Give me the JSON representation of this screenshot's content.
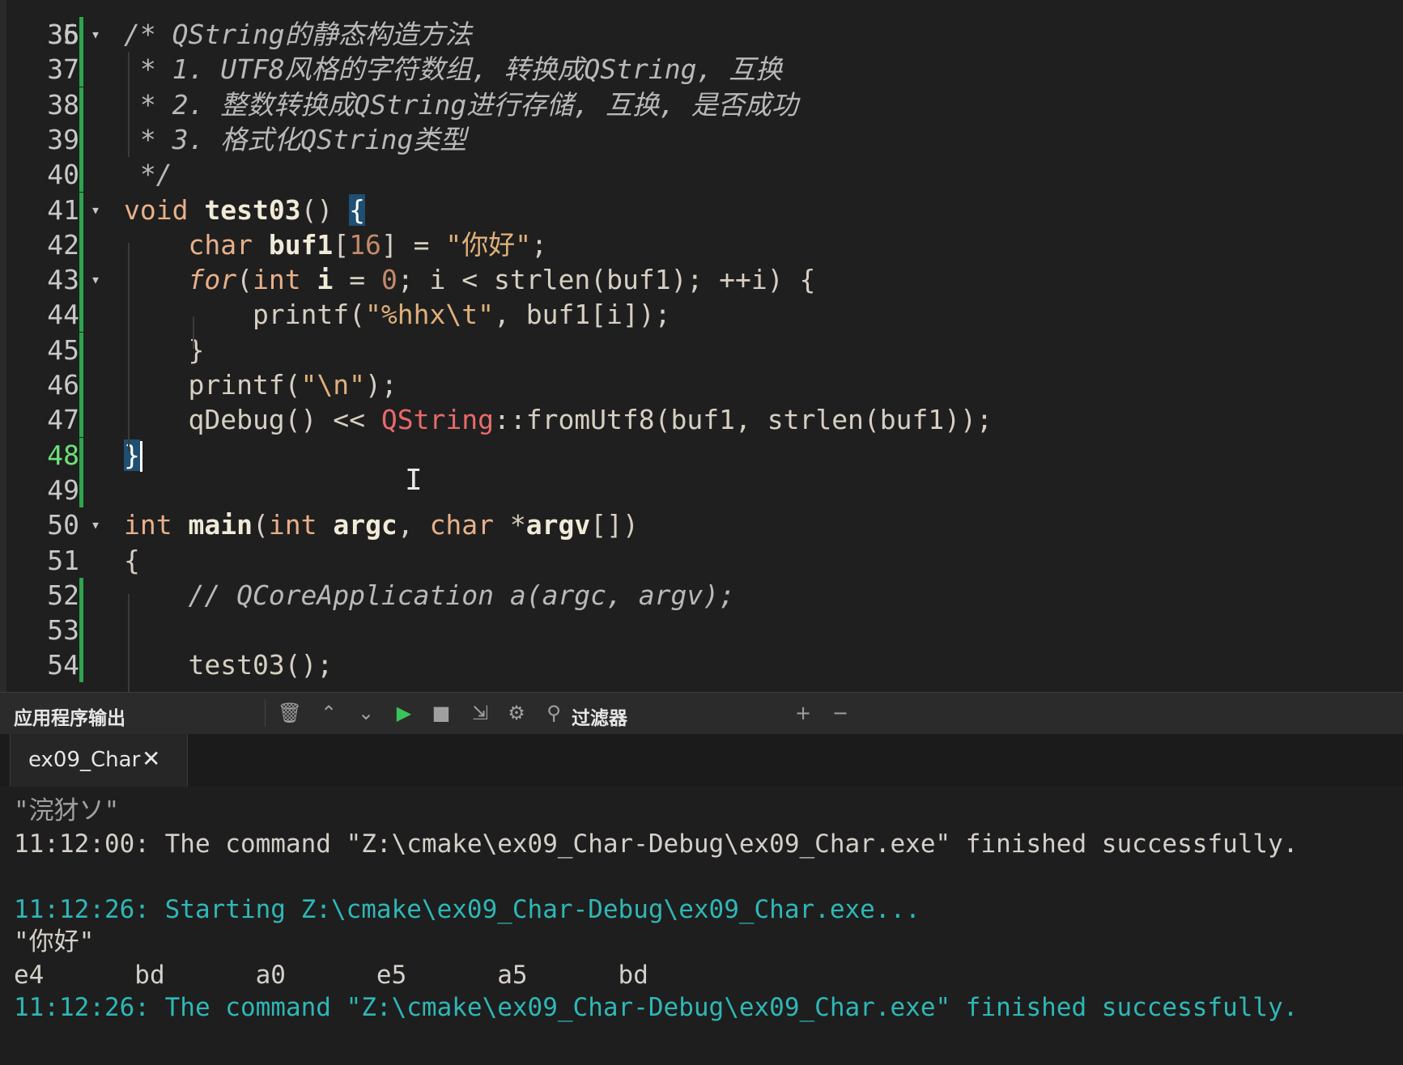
{
  "editor": {
    "lines": [
      {
        "n": "36",
        "fold": true,
        "mod": true,
        "segs": [
          {
            "c": "c-com",
            "t": "/* QString的静态构造方法"
          }
        ]
      },
      {
        "n": "37",
        "fold": false,
        "mod": true,
        "segs": [
          {
            "c": "c-com",
            "t": " * 1. UTF8风格的字符数组, 转换成QString, 互换"
          }
        ]
      },
      {
        "n": "38",
        "fold": false,
        "mod": true,
        "segs": [
          {
            "c": "c-com",
            "t": " * 2. 整数转换成QString进行存储, 互换, 是否成功"
          }
        ]
      },
      {
        "n": "39",
        "fold": false,
        "mod": true,
        "segs": [
          {
            "c": "c-com",
            "t": " * 3. 格式化QString类型"
          }
        ]
      },
      {
        "n": "40",
        "fold": false,
        "mod": true,
        "segs": [
          {
            "c": "c-com",
            "t": " */"
          }
        ]
      },
      {
        "n": "41",
        "fold": true,
        "mod": true,
        "segs": [
          {
            "c": "c-kw",
            "t": "void "
          },
          {
            "c": "c-fn",
            "t": "test03"
          },
          {
            "c": "",
            "t": "() "
          },
          {
            "c": "brace-hl",
            "t": "{"
          }
        ]
      },
      {
        "n": "42",
        "fold": false,
        "mod": true,
        "segs": [
          {
            "c": "",
            "t": "    "
          },
          {
            "c": "c-kw",
            "t": "char "
          },
          {
            "c": "c-fn",
            "t": "buf1"
          },
          {
            "c": "",
            "t": "["
          },
          {
            "c": "c-num",
            "t": "16"
          },
          {
            "c": "",
            "t": "] = "
          },
          {
            "c": "c-str",
            "t": "\"你好\""
          },
          {
            "c": "",
            "t": ";"
          }
        ]
      },
      {
        "n": "43",
        "fold": true,
        "mod": true,
        "segs": [
          {
            "c": "",
            "t": "    "
          },
          {
            "c": "c-kw c-it",
            "t": "for"
          },
          {
            "c": "",
            "t": "("
          },
          {
            "c": "c-kw",
            "t": "int "
          },
          {
            "c": "c-fn",
            "t": "i"
          },
          {
            "c": "",
            "t": " = "
          },
          {
            "c": "c-num",
            "t": "0"
          },
          {
            "c": "",
            "t": "; i < strlen(buf1); ++i) {"
          }
        ]
      },
      {
        "n": "44",
        "fold": false,
        "mod": true,
        "segs": [
          {
            "c": "",
            "t": "        printf("
          },
          {
            "c": "c-str",
            "t": "\"%hhx\\t\""
          },
          {
            "c": "",
            "t": ", buf1[i]);"
          }
        ]
      },
      {
        "n": "45",
        "fold": false,
        "mod": true,
        "segs": [
          {
            "c": "",
            "t": "    }"
          }
        ]
      },
      {
        "n": "46",
        "fold": false,
        "mod": true,
        "segs": [
          {
            "c": "",
            "t": "    printf("
          },
          {
            "c": "c-str",
            "t": "\"\\n\""
          },
          {
            "c": "",
            "t": ");"
          }
        ]
      },
      {
        "n": "47",
        "fold": false,
        "mod": true,
        "segs": [
          {
            "c": "",
            "t": "    qDebug() << "
          },
          {
            "c": "c-cls",
            "t": "QString"
          },
          {
            "c": "",
            "t": "::fromUtf8(buf1, strlen(buf1));"
          }
        ]
      },
      {
        "n": "48",
        "fold": false,
        "mod": true,
        "current": true,
        "segs": [
          {
            "c": "brace-hl",
            "t": "}"
          }
        ],
        "caret": true
      },
      {
        "n": "49",
        "fold": false,
        "mod": true,
        "segs": []
      },
      {
        "n": "50",
        "fold": true,
        "mod": false,
        "segs": [
          {
            "c": "c-kw",
            "t": "int "
          },
          {
            "c": "c-fn",
            "t": "main"
          },
          {
            "c": "",
            "t": "("
          },
          {
            "c": "c-kw",
            "t": "int "
          },
          {
            "c": "c-fn",
            "t": "argc"
          },
          {
            "c": "",
            "t": ", "
          },
          {
            "c": "c-kw",
            "t": "char "
          },
          {
            "c": "",
            "t": "*"
          },
          {
            "c": "c-fn",
            "t": "argv"
          },
          {
            "c": "",
            "t": "[])"
          }
        ]
      },
      {
        "n": "51",
        "fold": false,
        "mod": false,
        "segs": [
          {
            "c": "",
            "t": "{"
          }
        ]
      },
      {
        "n": "52",
        "fold": false,
        "mod": true,
        "segs": [
          {
            "c": "",
            "t": "    "
          },
          {
            "c": "c-com",
            "t": "// QCoreApplication a(argc, argv);"
          }
        ]
      },
      {
        "n": "53",
        "fold": false,
        "mod": true,
        "segs": []
      },
      {
        "n": "54",
        "fold": false,
        "mod": true,
        "segs": [
          {
            "c": "",
            "t": "    test03();"
          }
        ]
      }
    ],
    "top_partial_line_number": "35"
  },
  "output_pane": {
    "title": "应用程序输出",
    "filter_label": "过滤器",
    "icons": {
      "clear": "trash-icon",
      "prev": "chevron-up-icon",
      "next": "chevron-down-icon",
      "run": "play-icon",
      "stop": "stop-icon",
      "attach": "attach-icon",
      "settings": "gear-icon",
      "filter": "search-icon",
      "zoom_in": "plus-icon",
      "zoom_out": "minus-icon"
    },
    "tab": {
      "label": "ex09_Char",
      "close": "✕"
    },
    "lines": [
      {
        "cls": "garbled",
        "t": "\"浣犲ソ\""
      },
      {
        "cls": "",
        "t": "11:12:00: The command \"Z:\\cmake\\ex09_Char-Debug\\ex09_Char.exe\" finished successfully."
      },
      {
        "cls": "",
        "t": ""
      },
      {
        "cls": "run",
        "t": "11:12:26: Starting Z:\\cmake\\ex09_Char-Debug\\ex09_Char.exe..."
      },
      {
        "cls": "",
        "t": "\"你好\""
      },
      {
        "cls": "",
        "t": "e4      bd      a0      e5      a5      bd"
      },
      {
        "cls": "run",
        "t": "11:12:26: The command \"Z:\\cmake\\ex09_Char-Debug\\ex09_Char.exe\" finished successfully."
      }
    ]
  },
  "colors": {
    "background": "#1e1e1e",
    "modified_bar": "#2da44e",
    "current_line_number": "#6ee07a",
    "run_output": "#2fb7b7",
    "play": "#3cc25a"
  }
}
